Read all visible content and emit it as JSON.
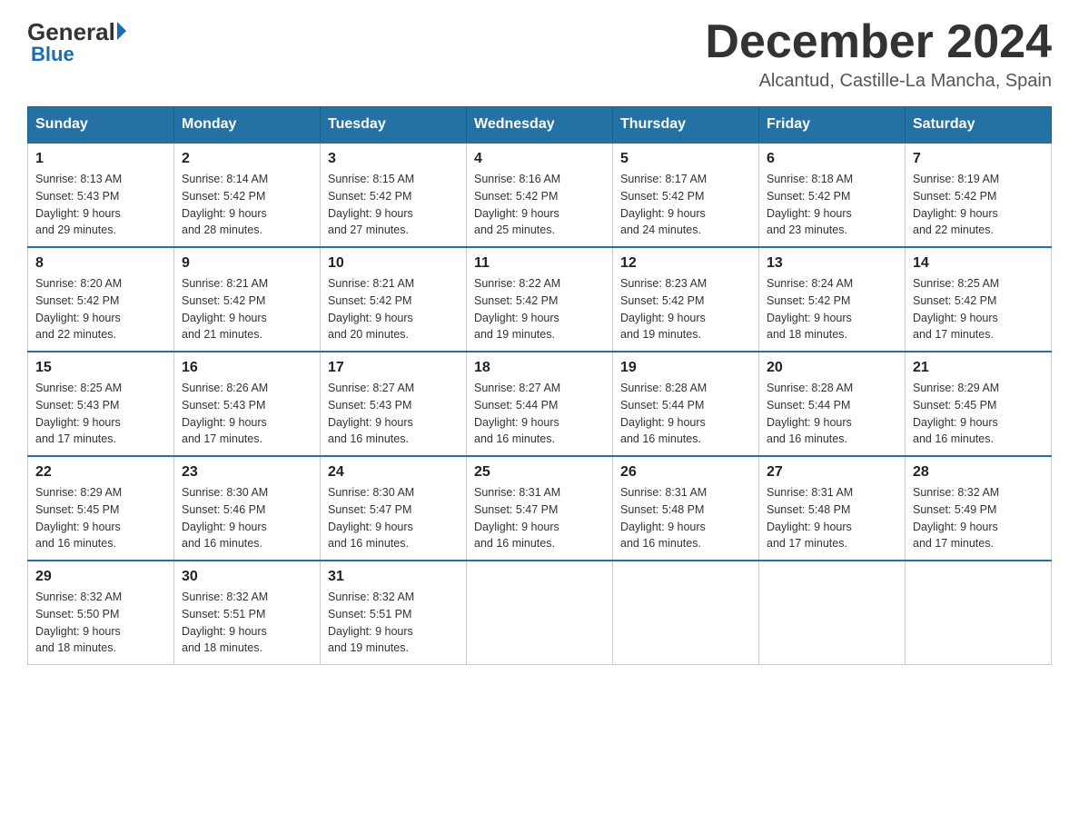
{
  "header": {
    "logo_general": "General",
    "logo_blue": "Blue",
    "month_title": "December 2024",
    "location": "Alcantud, Castille-La Mancha, Spain"
  },
  "days_of_week": [
    "Sunday",
    "Monday",
    "Tuesday",
    "Wednesday",
    "Thursday",
    "Friday",
    "Saturday"
  ],
  "weeks": [
    [
      {
        "day": "1",
        "sunrise": "8:13 AM",
        "sunset": "5:43 PM",
        "daylight_hours": "9",
        "daylight_minutes": "29"
      },
      {
        "day": "2",
        "sunrise": "8:14 AM",
        "sunset": "5:42 PM",
        "daylight_hours": "9",
        "daylight_minutes": "28"
      },
      {
        "day": "3",
        "sunrise": "8:15 AM",
        "sunset": "5:42 PM",
        "daylight_hours": "9",
        "daylight_minutes": "27"
      },
      {
        "day": "4",
        "sunrise": "8:16 AM",
        "sunset": "5:42 PM",
        "daylight_hours": "9",
        "daylight_minutes": "25"
      },
      {
        "day": "5",
        "sunrise": "8:17 AM",
        "sunset": "5:42 PM",
        "daylight_hours": "9",
        "daylight_minutes": "24"
      },
      {
        "day": "6",
        "sunrise": "8:18 AM",
        "sunset": "5:42 PM",
        "daylight_hours": "9",
        "daylight_minutes": "23"
      },
      {
        "day": "7",
        "sunrise": "8:19 AM",
        "sunset": "5:42 PM",
        "daylight_hours": "9",
        "daylight_minutes": "22"
      }
    ],
    [
      {
        "day": "8",
        "sunrise": "8:20 AM",
        "sunset": "5:42 PM",
        "daylight_hours": "9",
        "daylight_minutes": "22"
      },
      {
        "day": "9",
        "sunrise": "8:21 AM",
        "sunset": "5:42 PM",
        "daylight_hours": "9",
        "daylight_minutes": "21"
      },
      {
        "day": "10",
        "sunrise": "8:21 AM",
        "sunset": "5:42 PM",
        "daylight_hours": "9",
        "daylight_minutes": "20"
      },
      {
        "day": "11",
        "sunrise": "8:22 AM",
        "sunset": "5:42 PM",
        "daylight_hours": "9",
        "daylight_minutes": "19"
      },
      {
        "day": "12",
        "sunrise": "8:23 AM",
        "sunset": "5:42 PM",
        "daylight_hours": "9",
        "daylight_minutes": "19"
      },
      {
        "day": "13",
        "sunrise": "8:24 AM",
        "sunset": "5:42 PM",
        "daylight_hours": "9",
        "daylight_minutes": "18"
      },
      {
        "day": "14",
        "sunrise": "8:25 AM",
        "sunset": "5:42 PM",
        "daylight_hours": "9",
        "daylight_minutes": "17"
      }
    ],
    [
      {
        "day": "15",
        "sunrise": "8:25 AM",
        "sunset": "5:43 PM",
        "daylight_hours": "9",
        "daylight_minutes": "17"
      },
      {
        "day": "16",
        "sunrise": "8:26 AM",
        "sunset": "5:43 PM",
        "daylight_hours": "9",
        "daylight_minutes": "17"
      },
      {
        "day": "17",
        "sunrise": "8:27 AM",
        "sunset": "5:43 PM",
        "daylight_hours": "9",
        "daylight_minutes": "16"
      },
      {
        "day": "18",
        "sunrise": "8:27 AM",
        "sunset": "5:44 PM",
        "daylight_hours": "9",
        "daylight_minutes": "16"
      },
      {
        "day": "19",
        "sunrise": "8:28 AM",
        "sunset": "5:44 PM",
        "daylight_hours": "9",
        "daylight_minutes": "16"
      },
      {
        "day": "20",
        "sunrise": "8:28 AM",
        "sunset": "5:44 PM",
        "daylight_hours": "9",
        "daylight_minutes": "16"
      },
      {
        "day": "21",
        "sunrise": "8:29 AM",
        "sunset": "5:45 PM",
        "daylight_hours": "9",
        "daylight_minutes": "16"
      }
    ],
    [
      {
        "day": "22",
        "sunrise": "8:29 AM",
        "sunset": "5:45 PM",
        "daylight_hours": "9",
        "daylight_minutes": "16"
      },
      {
        "day": "23",
        "sunrise": "8:30 AM",
        "sunset": "5:46 PM",
        "daylight_hours": "9",
        "daylight_minutes": "16"
      },
      {
        "day": "24",
        "sunrise": "8:30 AM",
        "sunset": "5:47 PM",
        "daylight_hours": "9",
        "daylight_minutes": "16"
      },
      {
        "day": "25",
        "sunrise": "8:31 AM",
        "sunset": "5:47 PM",
        "daylight_hours": "9",
        "daylight_minutes": "16"
      },
      {
        "day": "26",
        "sunrise": "8:31 AM",
        "sunset": "5:48 PM",
        "daylight_hours": "9",
        "daylight_minutes": "16"
      },
      {
        "day": "27",
        "sunrise": "8:31 AM",
        "sunset": "5:48 PM",
        "daylight_hours": "9",
        "daylight_minutes": "17"
      },
      {
        "day": "28",
        "sunrise": "8:32 AM",
        "sunset": "5:49 PM",
        "daylight_hours": "9",
        "daylight_minutes": "17"
      }
    ],
    [
      {
        "day": "29",
        "sunrise": "8:32 AM",
        "sunset": "5:50 PM",
        "daylight_hours": "9",
        "daylight_minutes": "18"
      },
      {
        "day": "30",
        "sunrise": "8:32 AM",
        "sunset": "5:51 PM",
        "daylight_hours": "9",
        "daylight_minutes": "18"
      },
      {
        "day": "31",
        "sunrise": "8:32 AM",
        "sunset": "5:51 PM",
        "daylight_hours": "9",
        "daylight_minutes": "19"
      },
      null,
      null,
      null,
      null
    ]
  ]
}
